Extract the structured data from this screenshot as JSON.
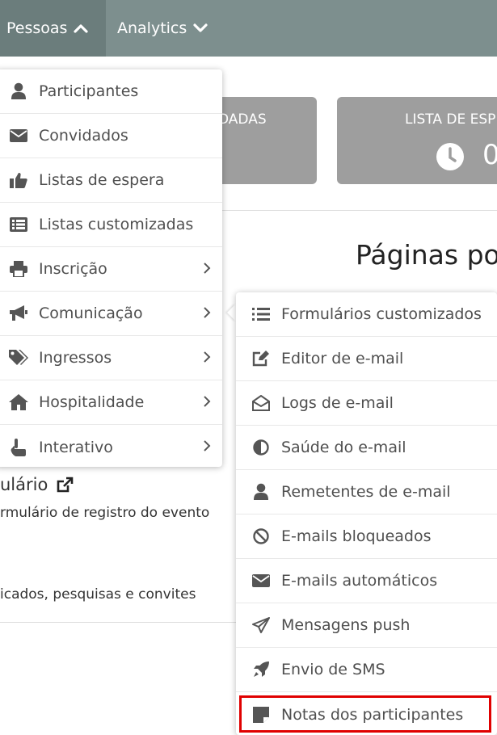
{
  "nav": {
    "pessoas_label": "Pessoas",
    "analytics_label": "Analytics"
  },
  "cards": [
    {
      "title": "DADAS"
    },
    {
      "title": "LISTA DE ESPE",
      "value": "0"
    }
  ],
  "main": {
    "paginas_title": "Páginas po",
    "form_title": "ulário",
    "form_desc": "rmulário de registro do evento",
    "comm_desc": "icados, pesquisas e convites"
  },
  "pessoas_menu": [
    {
      "label": "Participantes",
      "icon": "user-icon"
    },
    {
      "label": "Convidados",
      "icon": "envelope-icon"
    },
    {
      "label": "Listas de espera",
      "icon": "thumbs-up-icon"
    },
    {
      "label": "Listas customizadas",
      "icon": "list-icon"
    },
    {
      "label": "Inscrição",
      "icon": "printer-icon",
      "submenu": true
    },
    {
      "label": "Comunicação",
      "icon": "megaphone-icon",
      "submenu": true
    },
    {
      "label": "Ingressos",
      "icon": "tags-icon",
      "submenu": true
    },
    {
      "label": "Hospitalidade",
      "icon": "home-icon",
      "submenu": true
    },
    {
      "label": "Interativo",
      "icon": "pointer-hand-icon",
      "submenu": true
    }
  ],
  "comunicacao_menu": [
    {
      "label": "Formulários customizados",
      "icon": "list-ul-icon"
    },
    {
      "label": "Editor de e-mail",
      "icon": "edit-icon"
    },
    {
      "label": "Logs de e-mail",
      "icon": "envelope-open-icon"
    },
    {
      "label": "Saúde do e-mail",
      "icon": "half-circle-icon"
    },
    {
      "label": "Remetentes de e-mail",
      "icon": "user-icon"
    },
    {
      "label": "E-mails bloqueados",
      "icon": "ban-icon"
    },
    {
      "label": "E-mails automáticos",
      "icon": "envelope-icon"
    },
    {
      "label": "Mensagens push",
      "icon": "paper-plane-icon"
    },
    {
      "label": "Envio de SMS",
      "icon": "rocket-icon"
    },
    {
      "label": "Notas dos participantes",
      "icon": "sticky-note-icon",
      "highlighted": true
    }
  ],
  "colors": {
    "topbar": "#7d8f8e",
    "topbar_active": "#6b7d7c",
    "card": "#9e9e9e",
    "highlight": "#e00000",
    "menu_text": "#4f4f4f"
  }
}
